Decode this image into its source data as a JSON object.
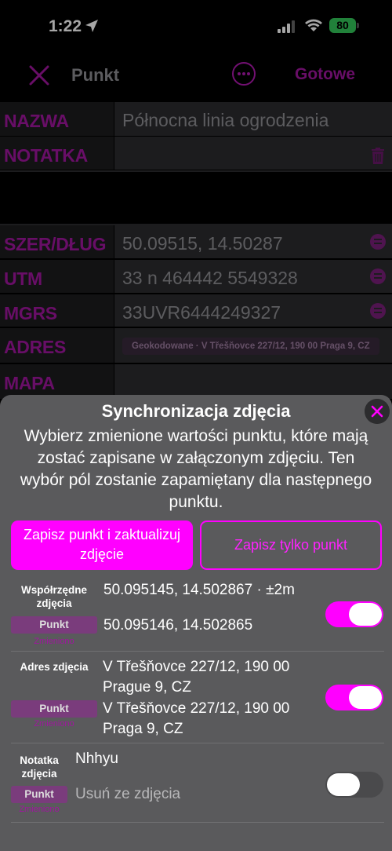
{
  "status": {
    "time": "1:22",
    "battery": "80"
  },
  "nav": {
    "title": "Punkt",
    "done": "Gotowe"
  },
  "form": {
    "name_label": "NAZWA",
    "name_value": "Północna linia ogrodzenia",
    "note_label": "NOTATKA",
    "latlon_label": "SZER/DŁUG",
    "latlon_value": "50.09515, 14.50287",
    "utm_label": "UTM",
    "utm_value": "33 n 464442 5549328",
    "mgrs_label": "MGRS",
    "mgrs_value": "33UVR6444249327",
    "address_label": "ADRES",
    "address_chip": "Geokodowane · V Třešňovce 227/12, 190 00 Praga 9, CZ",
    "map_label": "MAPA"
  },
  "sheet": {
    "title": "Synchronizacja zdjęcia",
    "description": "Wybierz zmienione wartości punktu, które mają zostać zapisane w załączonym zdjęciu. Ten wybór pól zostanie zapamiętany dla następnego punktu.",
    "btn_primary": "Zapisz punkt i zaktualizuj zdjęcie",
    "btn_secondary": "Zapisz tylko punkt",
    "rows": [
      {
        "label": "Współrzędne zdjęcia",
        "photo_value": "50.095145, 14.502867 · ±2m",
        "point_chip": "Punkt",
        "changed": "Zmieniono",
        "point_value": "50.095146, 14.502865",
        "enabled": true
      },
      {
        "label": "Adres zdjęcia",
        "photo_value": "V Třešňovce 227/12, 190 00 Prague 9, CZ",
        "point_chip": "Punkt",
        "changed": "Zmieniono",
        "point_value": "V Třešňovce 227/12, 190 00 Praga 9, CZ",
        "enabled": true
      },
      {
        "label": "Notatka zdjęcia",
        "photo_value": "Nhhyu",
        "point_chip": "Punkt",
        "changed": "Zmieniono",
        "point_value": "Usuń ze zdjęcia",
        "enabled": false
      }
    ]
  },
  "colors": {
    "accent": "#ff00ff",
    "label": "#a0169f"
  }
}
